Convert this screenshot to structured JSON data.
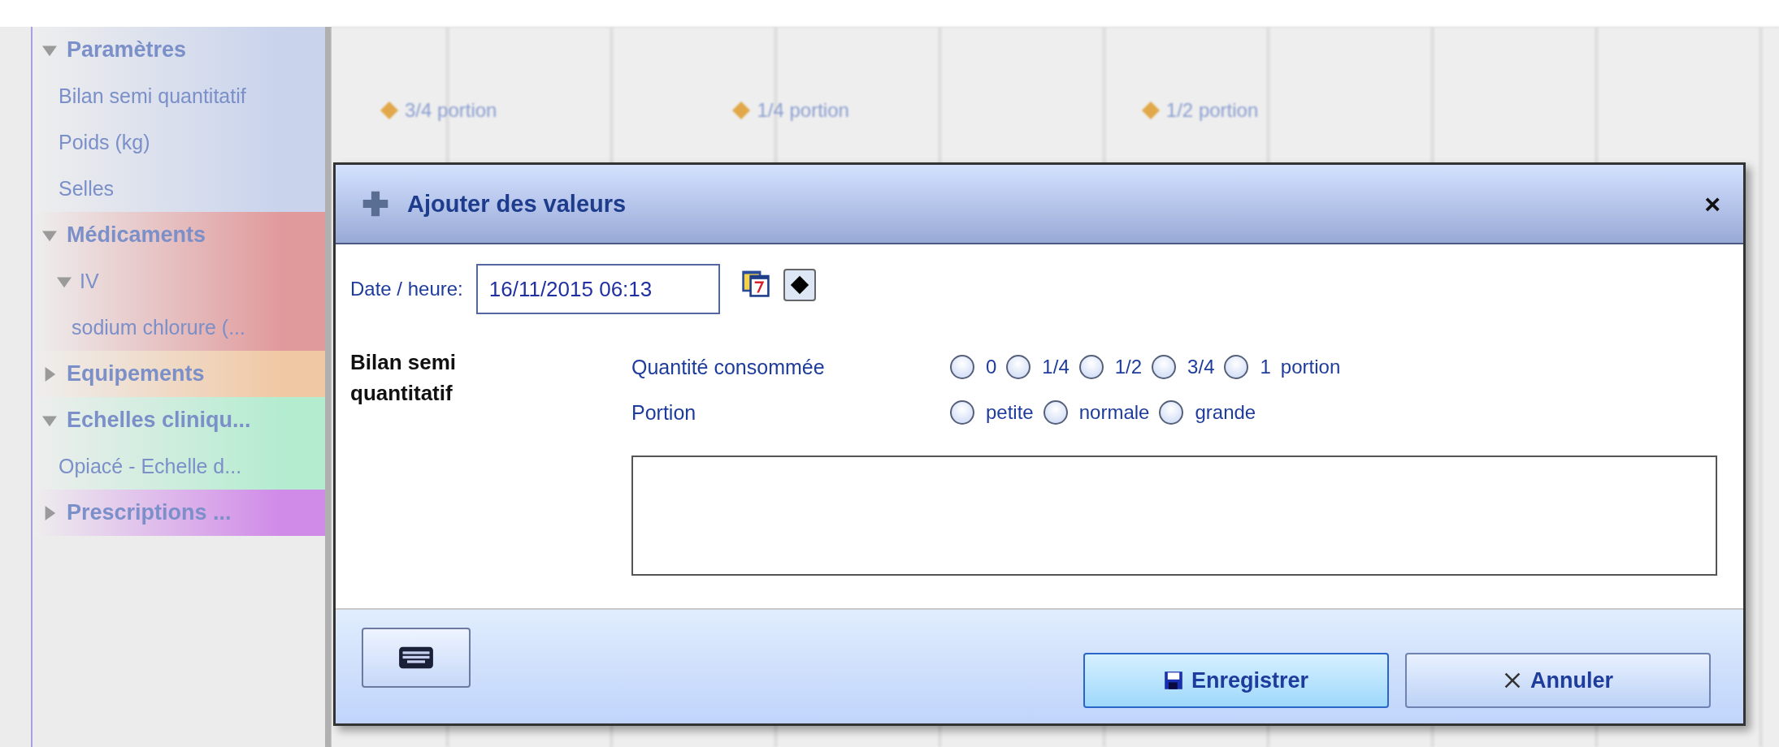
{
  "sidebar": {
    "groups": [
      {
        "label": "Paramètres",
        "color": "#c9d3ec",
        "expanded": true,
        "children": [
          {
            "label": "Bilan semi quantitatif"
          },
          {
            "label": "Poids (kg)"
          },
          {
            "label": "Selles"
          }
        ]
      },
      {
        "label": "Médicaments",
        "color": "#e09a9c",
        "expanded": true,
        "children": [
          {
            "label": "IV",
            "expanded": true,
            "children": [
              {
                "label": "sodium chlorure (..."
              }
            ]
          }
        ]
      },
      {
        "label": "Equipements",
        "color": "#f0c8a4",
        "expanded": false
      },
      {
        "label": "Echelles cliniqu...",
        "color": "#b4ecd0",
        "expanded": true,
        "children": [
          {
            "label": "Opiacé - Echelle d..."
          }
        ]
      },
      {
        "label": "Prescriptions ...",
        "color": "#d08ae8",
        "expanded": false
      }
    ]
  },
  "grid": {
    "events": [
      {
        "label": "3/4 portion"
      },
      {
        "label": "1/4 portion"
      },
      {
        "label": "1/2 portion"
      }
    ]
  },
  "dialog": {
    "title": "Ajouter des valeurs",
    "close": "×",
    "date_label": "Date / heure:",
    "date_value": "16/11/2015 06:13",
    "section": "Bilan semi quantitatif",
    "fields": [
      {
        "label": "Quantité consommée",
        "unit": "portion",
        "options": [
          {
            "label": "0",
            "selected": false
          },
          {
            "label": "1/4",
            "selected": false
          },
          {
            "label": "1/2",
            "selected": false
          },
          {
            "label": "3/4",
            "selected": false
          },
          {
            "label": "1",
            "selected": false
          }
        ]
      },
      {
        "label": "Portion",
        "options": [
          {
            "label": "petite",
            "selected": false
          },
          {
            "label": "normale",
            "selected": false
          },
          {
            "label": "grande",
            "selected": false
          }
        ]
      }
    ],
    "buttons": [
      {
        "label": "Enregistrer",
        "kind": "save",
        "selected": true
      },
      {
        "label": "Annuler",
        "kind": "cancel",
        "selected": false
      }
    ]
  }
}
